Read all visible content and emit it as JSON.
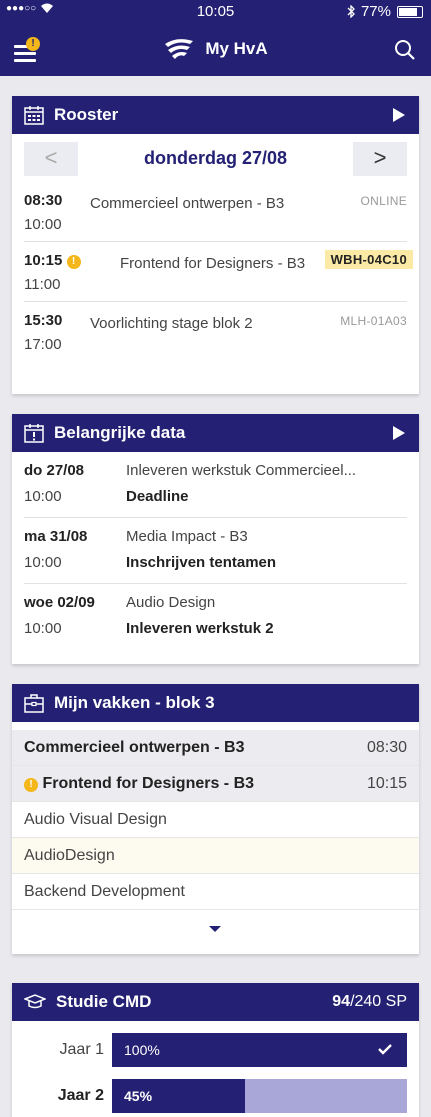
{
  "status": {
    "time": "10:05",
    "battery": "77%"
  },
  "app": {
    "title": "My HvA",
    "menu_badge": "!"
  },
  "rooster": {
    "title": "Rooster",
    "prev": "<",
    "next": ">",
    "date": "donderdag 27/08",
    "items": [
      {
        "start": "08:30",
        "end": "10:00",
        "course": "Commercieel ontwerpen - B3",
        "room": "ONLINE"
      },
      {
        "start": "10:15",
        "end": "11:00",
        "course": "Frontend for Designers - B3",
        "room": "WBH-04C10",
        "alert": "!"
      },
      {
        "start": "15:30",
        "end": "17:00",
        "course": "Voorlichting stage blok 2",
        "room": "MLH-01A03"
      }
    ]
  },
  "belangrijke": {
    "title": "Belangrijke data",
    "items": [
      {
        "day": "do 27/08",
        "time": "10:00",
        "course": "Inleveren werkstuk Commercieel...",
        "type": "Deadline"
      },
      {
        "day": "ma 31/08",
        "time": "10:00",
        "course": "Media Impact - B3",
        "type": "Inschrijven tentamen"
      },
      {
        "day": "woe 02/09",
        "time": "10:00",
        "course": "Audio Design",
        "type": "Inleveren werkstuk 2"
      }
    ]
  },
  "vakken": {
    "title": "Mijn vakken - blok 3",
    "items": [
      {
        "name": "Commercieel ontwerpen - B3",
        "time": "08:30"
      },
      {
        "name": "Frontend for Designers - B3",
        "time": "10:15",
        "alert": "!"
      },
      {
        "name": "Audio Visual Design",
        "time": ""
      },
      {
        "name": "AudioDesign",
        "time": ""
      },
      {
        "name": "Backend Development",
        "time": ""
      }
    ]
  },
  "studie": {
    "title": "Studie CMD",
    "sp_earned": "94",
    "sp_total": "/240 SP",
    "years": [
      {
        "label": "Jaar 1",
        "pct_label": "100%",
        "progress": 1.0
      },
      {
        "label": "Jaar 2",
        "pct_label": "45%",
        "progress": 0.45
      }
    ]
  },
  "colors": {
    "primary": "#242174",
    "accent": "#f3b71a",
    "highlight": "#faeaa5",
    "track": "#a9a6d8"
  },
  "icons": [
    "menu-icon",
    "hva-logo-icon",
    "search-icon",
    "calendar-icon",
    "calendar-alert-icon",
    "briefcase-icon",
    "graduation-cap-icon",
    "play-icon",
    "check-icon",
    "chevron-down-icon"
  ]
}
